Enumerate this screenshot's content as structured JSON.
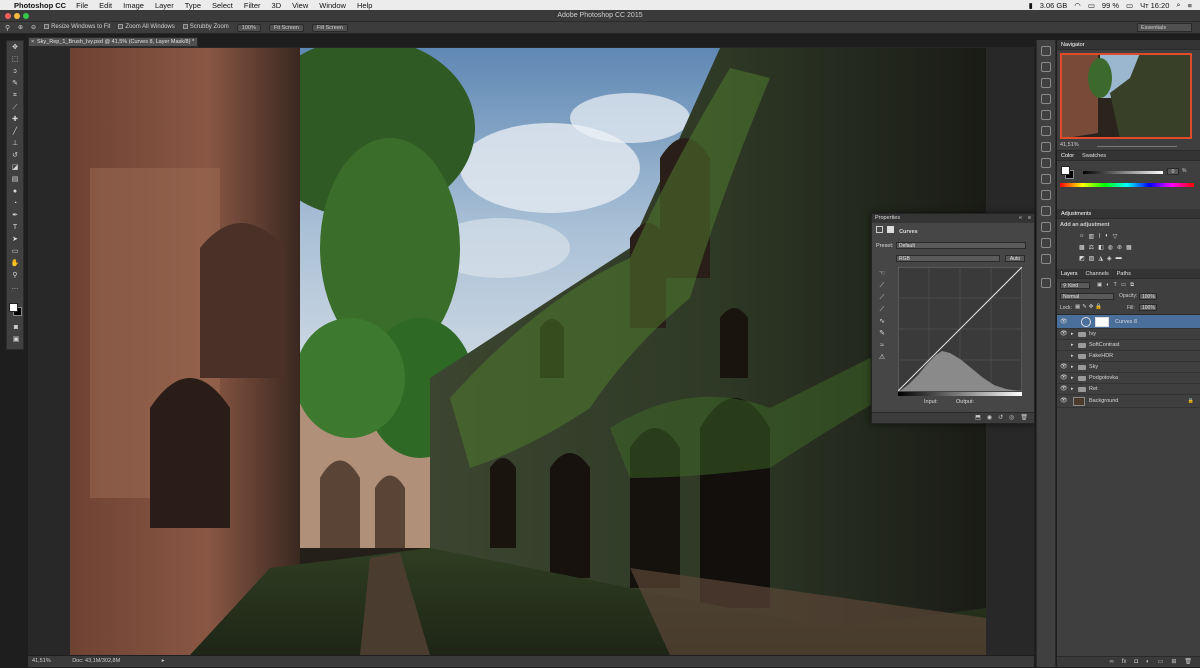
{
  "menubar": {
    "app_name": "Photoshop CC",
    "items": [
      "File",
      "Edit",
      "Image",
      "Layer",
      "Type",
      "Select",
      "Filter",
      "3D",
      "View",
      "Window",
      "Help"
    ],
    "memory": "3.06 GB",
    "battery": "99 %",
    "day_time": "Чт 16:20"
  },
  "window": {
    "title": "Adobe Photoshop CC 2015"
  },
  "options": {
    "resize_windows": "Resize Windows to Fit",
    "zoom_all": "Zoom All Windows",
    "scrubby": "Scrubby Zoom",
    "zoom_100": "100%",
    "fit_screen": "Fit Screen",
    "fill_screen": "Fill Screen",
    "workspace": "Essentials"
  },
  "document": {
    "tab_title": "Sky_Rep_1_Brush_Ivy.psd @ 41,5% (Curves 8, Layer Mask/8) *",
    "zoom": "41,51%",
    "doc_size": "Doc: 43,1M/302,8M"
  },
  "properties": {
    "tab": "Properties",
    "type": "Curves",
    "preset_label": "Preset:",
    "preset_value": "Default",
    "channel": "RGB",
    "auto": "Auto",
    "input_label": "Input:",
    "output_label": "Output:"
  },
  "navigator": {
    "tab": "Navigator",
    "zoom": "41,51%"
  },
  "color": {
    "tab_color": "Color",
    "tab_swatches": "Swatches",
    "value": "0",
    "unit": "%"
  },
  "adjustments": {
    "tab": "Adjustments",
    "hint": "Add an adjustment"
  },
  "layers": {
    "tab_layers": "Layers",
    "tab_channels": "Channels",
    "tab_paths": "Paths",
    "kind": "Kind",
    "blend_mode": "Normal",
    "opacity_label": "Opacity:",
    "opacity": "100%",
    "lock_label": "Lock:",
    "fill_label": "Fill:",
    "fill": "100%",
    "items": [
      {
        "name": "Curves 8",
        "kind": "adjustment",
        "selected": true
      },
      {
        "name": "Ivy",
        "kind": "group"
      },
      {
        "name": "SoftContrast",
        "kind": "group"
      },
      {
        "name": "FakeHDR",
        "kind": "group"
      },
      {
        "name": "Sky",
        "kind": "group"
      },
      {
        "name": "Podgotovka",
        "kind": "group"
      },
      {
        "name": "Ret",
        "kind": "group"
      },
      {
        "name": "Background",
        "kind": "pixel"
      }
    ]
  },
  "colors": {
    "accent": "#e04b2c",
    "selection": "#4a6f9a",
    "panel": "#3f3f3f"
  }
}
